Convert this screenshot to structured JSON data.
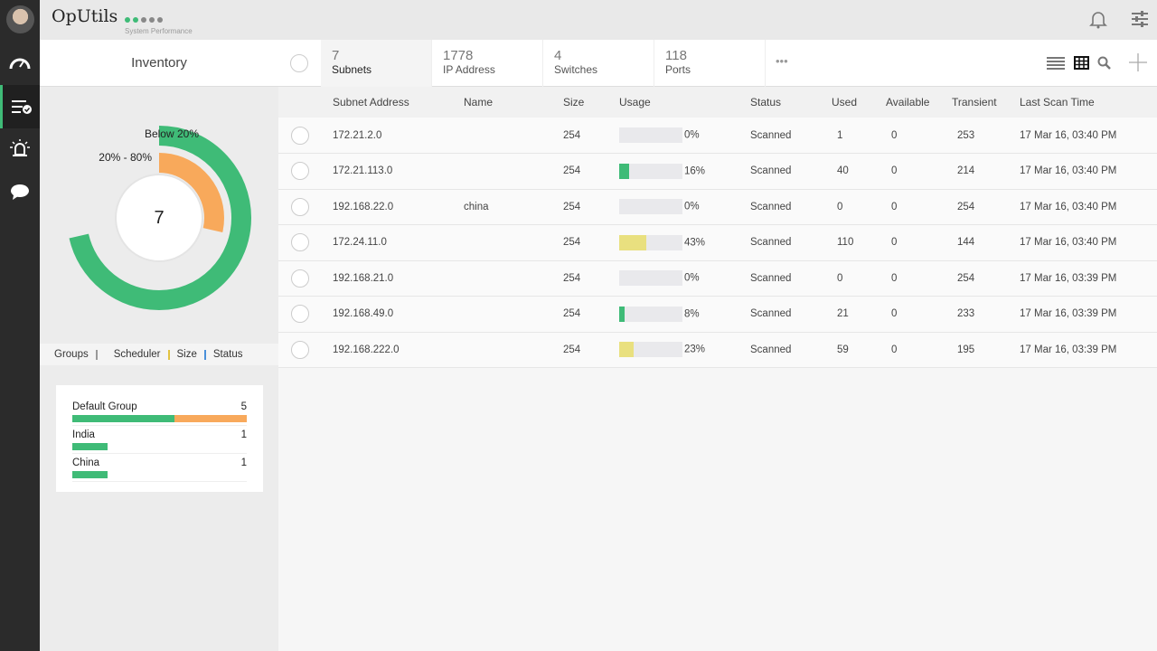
{
  "app": {
    "title": "OpUtils",
    "perf_label": "System Performance",
    "perf_level": 2,
    "perf_max": 5
  },
  "icons": {
    "avatar": "avatar",
    "dashboard": "speedometer-icon",
    "inventory": "list-check-icon",
    "alarms": "bell-alert-icon",
    "chat": "chat-icon",
    "notifications": "bell-icon",
    "settings": "sliders-icon",
    "list_view": "list-icon",
    "grid_view": "grid-icon",
    "search": "search-icon",
    "add": "plus-icon"
  },
  "inventory_label": "Inventory",
  "tabs": [
    {
      "count": "7",
      "label": "Subnets"
    },
    {
      "count": "1778",
      "label": "IP Address"
    },
    {
      "count": "4",
      "label": "Switches"
    },
    {
      "count": "118",
      "label": "Ports"
    }
  ],
  "more": "•••",
  "donut": {
    "center": "7",
    "legend": [
      "Below 20%",
      "20% - 80%"
    ],
    "values": [
      5,
      2
    ],
    "colors": [
      "#3fbb77",
      "#f8a95b"
    ]
  },
  "subtabs": [
    "Groups",
    "Scheduler",
    "Size",
    "Status"
  ],
  "groups": [
    {
      "name": "Default Group",
      "count": "5",
      "green": 5,
      "orange": 2
    },
    {
      "name": "India",
      "count": "1",
      "green": 1,
      "orange": 0
    },
    {
      "name": "China",
      "count": "1",
      "green": 1,
      "orange": 0
    }
  ],
  "columns": [
    "Subnet Address",
    "Name",
    "Size",
    "Usage",
    "Status",
    "Used",
    "Available",
    "Transient",
    "Last Scan Time"
  ],
  "rows": [
    {
      "addr": "172.21.2.0",
      "name": "",
      "size": "254",
      "usage": 0,
      "usage_text": "0%",
      "status": "Scanned",
      "used": "1",
      "avail": "0",
      "trans": "253",
      "time": "17 Mar 16, 03:40 PM"
    },
    {
      "addr": "172.21.113.0",
      "name": "",
      "size": "254",
      "usage": 16,
      "usage_text": "16%",
      "status": "Scanned",
      "used": "40",
      "avail": "0",
      "trans": "214",
      "time": "17 Mar 16, 03:40 PM"
    },
    {
      "addr": "192.168.22.0",
      "name": "china",
      "size": "254",
      "usage": 0,
      "usage_text": "0%",
      "status": "Scanned",
      "used": "0",
      "avail": "0",
      "trans": "254",
      "time": "17 Mar 16, 03:40 PM"
    },
    {
      "addr": "172.24.11.0",
      "name": "",
      "size": "254",
      "usage": 43,
      "usage_text": "43%",
      "status": "Scanned",
      "used": "110",
      "avail": "0",
      "trans": "144",
      "time": "17 Mar 16, 03:40 PM"
    },
    {
      "addr": "192.168.21.0",
      "name": "",
      "size": "254",
      "usage": 0,
      "usage_text": "0%",
      "status": "Scanned",
      "used": "0",
      "avail": "0",
      "trans": "254",
      "time": "17 Mar 16, 03:39 PM"
    },
    {
      "addr": "192.168.49.0",
      "name": "",
      "size": "254",
      "usage": 8,
      "usage_text": "8%",
      "status": "Scanned",
      "used": "21",
      "avail": "0",
      "trans": "233",
      "time": "17 Mar 16, 03:39 PM"
    },
    {
      "addr": "192.168.222.0",
      "name": "",
      "size": "254",
      "usage": 23,
      "usage_text": "23%",
      "status": "Scanned",
      "used": "59",
      "avail": "0",
      "trans": "195",
      "time": "17 Mar 16, 03:39 PM"
    }
  ]
}
